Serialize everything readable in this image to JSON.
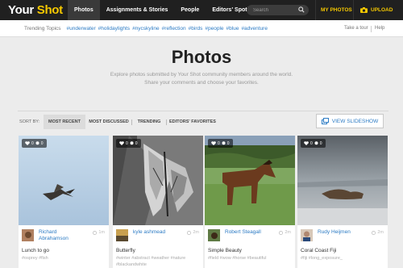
{
  "nav": {
    "logo_a": "Your",
    "logo_b": "Shot",
    "items": [
      "Photos",
      "Assignments & Stories",
      "People",
      "Editors' Spotlight"
    ],
    "search_placeholder": "Search",
    "my_photos": "MY PHOTOS",
    "upload": "UPLOAD"
  },
  "trending": {
    "label": "Trending Topics",
    "tags": [
      "#underwater",
      "#holidaylights",
      "#nycskyline",
      "#reflection",
      "#birds",
      "#people",
      "#blue",
      "#adventure"
    ],
    "tour": "Take a tour",
    "help": "Help"
  },
  "hero": {
    "title": "Photos",
    "line1": "Explore photos submitted by Your Shot community members around the world.",
    "line2": "Share your comments and choose your favorites."
  },
  "sort": {
    "label": "SORT BY:",
    "options": [
      "MOST RECENT",
      "MOST DISCUSSED",
      "TRENDING",
      "EDITORS' FAVORITES"
    ],
    "slideshow": "VIEW SLIDESHOW"
  },
  "cards": [
    {
      "likes": "0",
      "comments": "0",
      "user_line1": "Richard",
      "user_line2": "Abrahamson",
      "age": "1m",
      "title": "Lunch to go",
      "tags": "#osprey #fish"
    },
    {
      "likes": "0",
      "comments": "0",
      "user_line1": "kyle ashmead",
      "user_line2": "",
      "age": "2m",
      "title": "Butterfly",
      "tags": "#winter #abstract #weather #nature #blackandwhite"
    },
    {
      "likes": "0",
      "comments": "0",
      "user_line1": "Robert Steagall",
      "user_line2": "",
      "age": "2m",
      "title": "Simple Beauty",
      "tags": "#field #wow #horse #beautiful"
    },
    {
      "likes": "0",
      "comments": "0",
      "user_line1": "Rudy Heijmen",
      "user_line2": "",
      "age": "2m",
      "title": "Coral Coast Fiji",
      "tags": "#fiji #long_exposure_"
    }
  ],
  "colors": {
    "accent": "#f5c800",
    "link": "#2c7bc4",
    "nav_bg": "#202020"
  }
}
